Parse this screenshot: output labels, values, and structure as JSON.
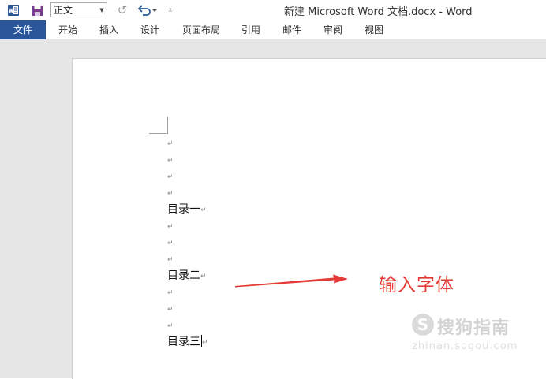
{
  "titlebar": {
    "style_value": "正文",
    "doc_title": "新建 Microsoft Word 文档.docx - Word"
  },
  "tabs": [
    {
      "label": "文件"
    },
    {
      "label": "开始"
    },
    {
      "label": "插入"
    },
    {
      "label": "设计"
    },
    {
      "label": "页面布局"
    },
    {
      "label": "引用"
    },
    {
      "label": "邮件"
    },
    {
      "label": "审阅"
    },
    {
      "label": "视图"
    }
  ],
  "document": {
    "paragraph_mark": "↵",
    "headings": [
      "目录一",
      "目录二",
      "目录三"
    ]
  },
  "annotation": {
    "text": "输入字体",
    "color": "#e53935"
  },
  "watermark": {
    "logo_glyph": "S",
    "name": "搜狗指南",
    "url": "zhinan.sogou.com"
  },
  "colors": {
    "accent": "#2b579a",
    "arrow": "#e53935"
  }
}
